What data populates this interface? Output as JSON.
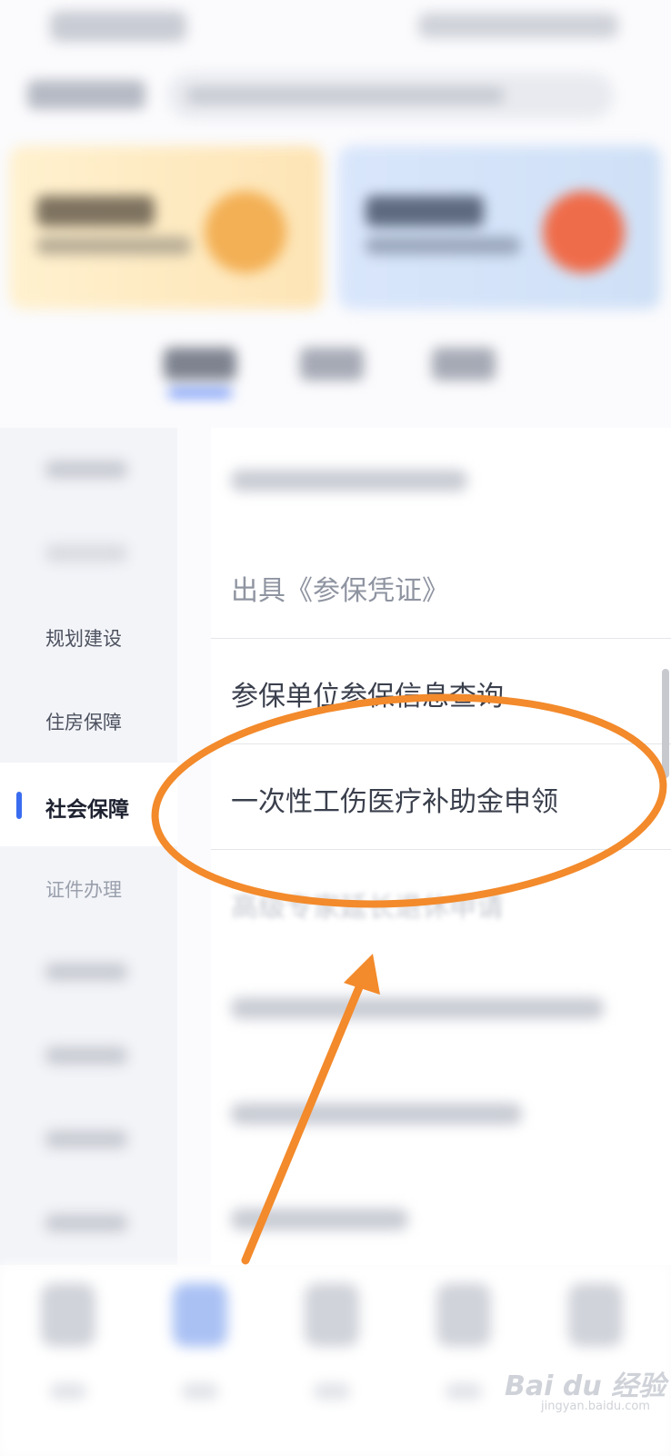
{
  "sidebar": {
    "items": [
      {
        "label": ""
      },
      {
        "label": ""
      },
      {
        "label": "规划建设"
      },
      {
        "label": "住房保障"
      },
      {
        "label": "社会保障"
      },
      {
        "label": "证件办理"
      },
      {
        "label": ""
      },
      {
        "label": ""
      },
      {
        "label": ""
      },
      {
        "label": ""
      }
    ],
    "active_index": 4
  },
  "list": {
    "items": [
      {
        "label": ""
      },
      {
        "label": "出具《参保凭证》"
      },
      {
        "label": "参保单位参保信息查询"
      },
      {
        "label": "一次性工伤医疗补助金申领"
      },
      {
        "label": "高级专家延长退休申请"
      },
      {
        "label": ""
      },
      {
        "label": ""
      },
      {
        "label": ""
      }
    ]
  },
  "annotation": {
    "highlight_color": "#f38a2b",
    "target": "一次性工伤医疗补助金申领"
  },
  "watermark": {
    "brand": "Bai du 经验",
    "domain": "jingyan.baidu.com"
  }
}
